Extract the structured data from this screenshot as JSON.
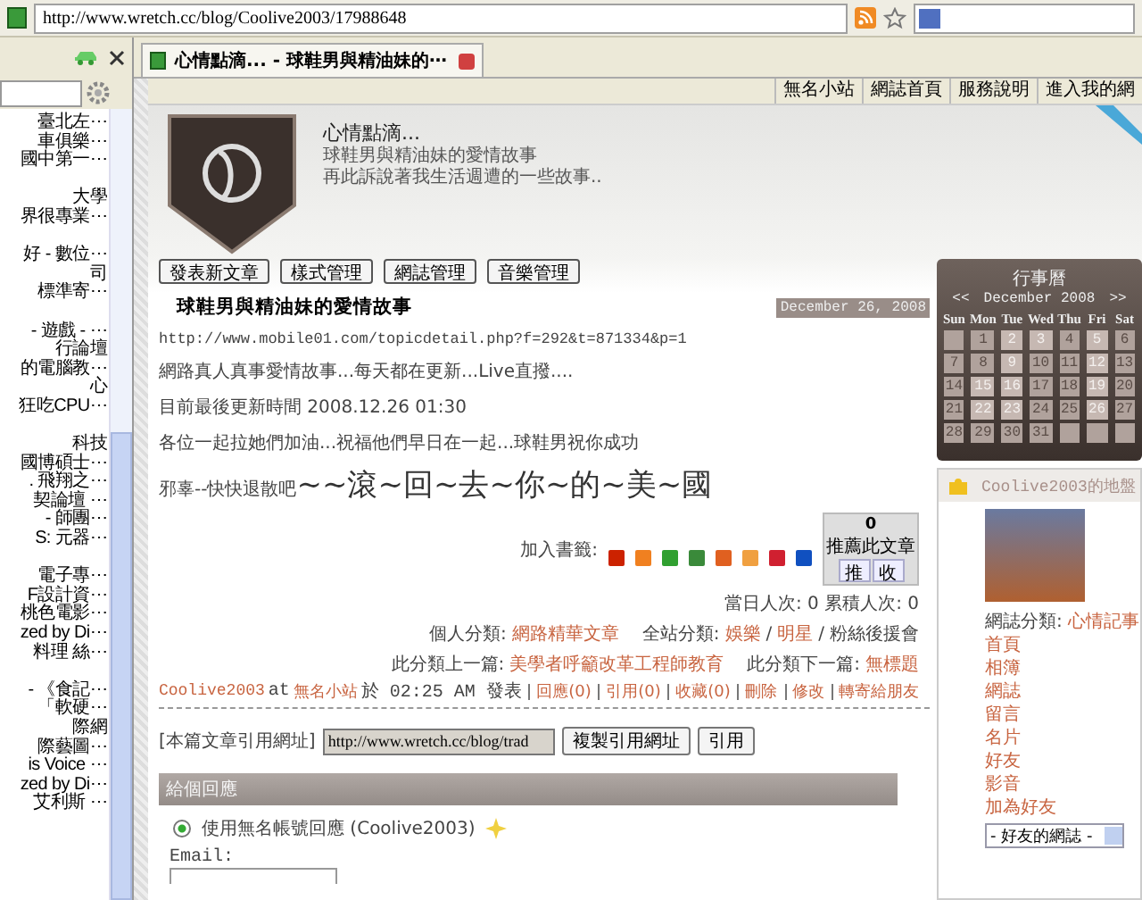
{
  "browser": {
    "url": "http://www.wretch.cc/blog/Coolive2003/17988648"
  },
  "sidebar": {
    "items": [
      {
        "label": "臺北左⋯",
        "gap_before": false
      },
      {
        "label": "車俱樂⋯",
        "gap_before": false
      },
      {
        "label": "國中第一⋯",
        "gap_before": false
      },
      {
        "label": "大學",
        "gap_before": true
      },
      {
        "label": "界很專業⋯",
        "gap_before": false
      },
      {
        "label": "好 - 數位⋯",
        "gap_before": true
      },
      {
        "label": "司",
        "gap_before": false
      },
      {
        "label": "標準寄⋯",
        "gap_before": false
      },
      {
        "label": "- 遊戲 - ⋯",
        "gap_before": true
      },
      {
        "label": "行論壇",
        "gap_before": false
      },
      {
        "label": "的電腦教⋯",
        "gap_before": false
      },
      {
        "label": "心",
        "gap_before": false
      },
      {
        "label": "狂吃CPU⋯",
        "gap_before": false
      },
      {
        "label": "科技",
        "gap_before": true
      },
      {
        "label": "國博碩士⋯",
        "gap_before": false
      },
      {
        "label": ". 飛翔之⋯",
        "gap_before": false
      },
      {
        "label": "契論壇 ⋯",
        "gap_before": false
      },
      {
        "label": "- 師團⋯",
        "gap_before": false
      },
      {
        "label": "S: 元器⋯",
        "gap_before": false
      },
      {
        "label": "電子專⋯",
        "gap_before": true
      },
      {
        "label": "F設計資⋯",
        "gap_before": false
      },
      {
        "label": "桃色電影⋯",
        "gap_before": false
      },
      {
        "label": "zed by Di⋯",
        "gap_before": false
      },
      {
        "label": "料理 絲⋯",
        "gap_before": false
      },
      {
        "label": "- 《食記⋯",
        "gap_before": true
      },
      {
        "label": "「軟硬⋯",
        "gap_before": false
      },
      {
        "label": "際網",
        "gap_before": false
      },
      {
        "label": "際藝圖⋯",
        "gap_before": false
      },
      {
        "label": "is Voice ⋯",
        "gap_before": false
      },
      {
        "label": "zed by Di⋯",
        "gap_before": false
      },
      {
        "label": "艾利斯 ⋯",
        "gap_before": false
      }
    ]
  },
  "tab": {
    "title": "心情點滴... - 球鞋男與精油妹的⋯"
  },
  "top_nav": [
    "無名小站",
    "網誌首頁",
    "服務說明",
    "進入我的網"
  ],
  "blog": {
    "title": "心情點滴...",
    "subtitle": [
      "球鞋男與精油妹的愛情故事",
      "再此訴說著我生活週遭的一些故事.."
    ]
  },
  "admin_buttons": [
    "發表新文章",
    "樣式管理",
    "網誌管理",
    "音樂管理"
  ],
  "post": {
    "title": "球鞋男與精油妹的愛情故事",
    "date": "December 26, 2008",
    "paragraphs": [
      "http://www.mobile01.com/topicdetail.php?f=292&t=871334&p=1",
      "網路真人真事愛情故事...每天都在更新...Live直撥....",
      "目前最後更新時間 2008.12.26 01:30",
      "各位一起拉她們加油...祝福他們早日在一起...球鞋男祝你成功"
    ],
    "closing_small": "邪辜--快快退散吧",
    "closing_big": "~~滾~回~去~你~的~美~國"
  },
  "recommend": {
    "count": "0",
    "label": "推薦此文章",
    "buttons": [
      "推",
      "收"
    ]
  },
  "bookmarks_label": "加入書籤:",
  "bookmark_icons": [
    {
      "color": "#cc2200"
    },
    {
      "color": "#f08020"
    },
    {
      "color": "#30a030"
    },
    {
      "color": "#3a8a3a"
    },
    {
      "color": "#e06020"
    },
    {
      "color": "#f0a040"
    },
    {
      "color": "#d02030"
    },
    {
      "color": "#1050c0"
    }
  ],
  "stats": "當日人次: 0 累積人次: 0",
  "categories": {
    "personal_label": "個人分類:",
    "personal": "網路精華文章",
    "site_label": "全站分類:",
    "site": [
      "娛樂",
      "明星"
    ],
    "site_separator": "/",
    "site_plain": "粉絲後援會"
  },
  "neighbors": {
    "prev_label": "此分類上一篇:",
    "prev": "美學者呼籲改革工程師教育",
    "next_label": "此分類下一篇:",
    "next": "無標題"
  },
  "footer": {
    "author": "Coolive2003",
    "at": "at",
    "site": "無名小站",
    "time": "於 02:25 AM 發表",
    "links": [
      "回應(0)",
      "引用(0)",
      "收藏(0)",
      "刪除",
      "修改",
      "轉寄給朋友"
    ]
  },
  "trackback": {
    "label": "[本篇文章引用網址]",
    "value": "http://www.wretch.cc/blog/trad",
    "buttons": [
      "複製引用網址",
      "引用"
    ]
  },
  "reply": {
    "header": "給個回應",
    "option": {
      "label": "使用無名帳號回應 (Coolive2003)",
      "selected": true
    },
    "email_label": "Email:"
  },
  "calendar": {
    "title": "行事曆",
    "prev": "<<",
    "month": "December 2008",
    "next": ">>",
    "weekdays": [
      "Sun",
      "Mon",
      "Tue",
      "Wed",
      "Thu",
      "Fri",
      "Sat"
    ],
    "days": [
      {
        "kind": "blank"
      },
      {
        "kind": "day",
        "day": "1",
        "marked": false
      },
      {
        "kind": "day",
        "day": "2",
        "marked": true
      },
      {
        "kind": "day",
        "day": "3",
        "marked": true
      },
      {
        "kind": "day",
        "day": "4",
        "marked": false
      },
      {
        "kind": "day",
        "day": "5",
        "marked": true
      },
      {
        "kind": "day",
        "day": "6",
        "marked": false
      },
      {
        "kind": "day",
        "day": "7",
        "marked": false
      },
      {
        "kind": "day",
        "day": "8",
        "marked": false
      },
      {
        "kind": "day",
        "day": "9",
        "marked": true
      },
      {
        "kind": "day",
        "day": "10",
        "marked": false
      },
      {
        "kind": "day",
        "day": "11",
        "marked": false
      },
      {
        "kind": "day",
        "day": "12",
        "marked": true
      },
      {
        "kind": "day",
        "day": "13",
        "marked": false
      },
      {
        "kind": "day",
        "day": "14",
        "marked": false
      },
      {
        "kind": "day",
        "day": "15",
        "marked": true
      },
      {
        "kind": "day",
        "day": "16",
        "marked": true
      },
      {
        "kind": "day",
        "day": "17",
        "marked": false
      },
      {
        "kind": "day",
        "day": "18",
        "marked": false
      },
      {
        "kind": "day",
        "day": "19",
        "marked": true
      },
      {
        "kind": "day",
        "day": "20",
        "marked": false
      },
      {
        "kind": "day",
        "day": "21",
        "marked": false
      },
      {
        "kind": "day",
        "day": "22",
        "marked": true
      },
      {
        "kind": "day",
        "day": "23",
        "marked": true
      },
      {
        "kind": "day",
        "day": "24",
        "marked": false
      },
      {
        "kind": "day",
        "day": "25",
        "marked": false
      },
      {
        "kind": "day",
        "day": "26",
        "marked": true
      },
      {
        "kind": "day",
        "day": "27",
        "marked": false
      },
      {
        "kind": "day",
        "day": "28",
        "marked": false
      },
      {
        "kind": "day",
        "day": "29",
        "marked": false
      },
      {
        "kind": "day",
        "day": "30",
        "marked": false
      },
      {
        "kind": "day",
        "day": "31",
        "marked": false
      },
      {
        "kind": "blank"
      },
      {
        "kind": "blank"
      },
      {
        "kind": "blank"
      }
    ]
  },
  "profile": {
    "title": "Coolive2003的地盤",
    "category_label": "網誌分類:",
    "category": "心情記事",
    "links": [
      "首頁",
      "相簿",
      "網誌",
      "留言",
      "名片",
      "好友",
      "影音",
      "加為好友"
    ],
    "select": "- 好友的網誌 -"
  }
}
